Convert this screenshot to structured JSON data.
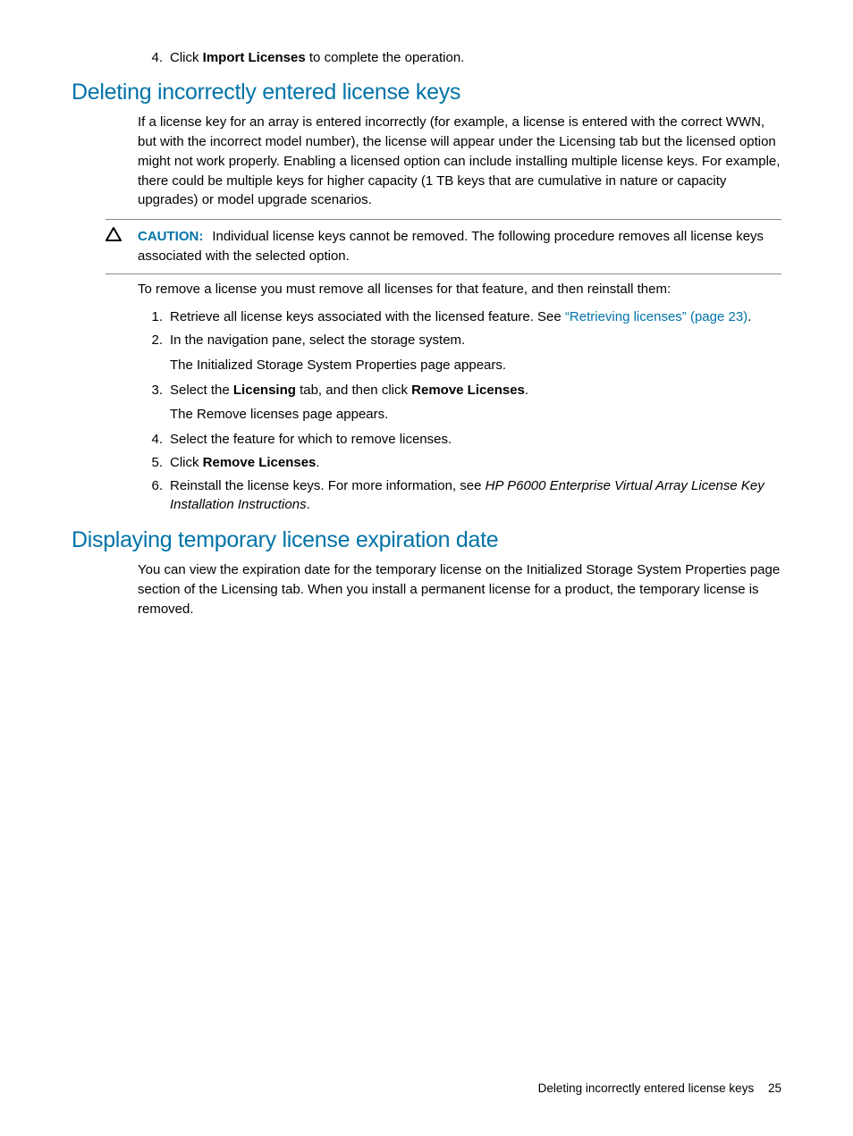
{
  "step4_top": {
    "num": "4.",
    "prefix": "Click ",
    "bold": "Import Licenses",
    "suffix": " to complete the operation."
  },
  "h2_deleting": "Deleting incorrectly entered license keys",
  "p_deleting": "If a license key for an array is entered incorrectly (for example, a license is entered with the correct WWN, but with the incorrect model number), the license will appear under the Licensing tab but the licensed option might not work properly. Enabling a licensed option can include installing multiple license keys. For example, there could be multiple keys for higher capacity (1 TB keys that are cumulative in nature or capacity upgrades) or model upgrade scenarios.",
  "caution": {
    "label": "CAUTION:",
    "text": "Individual license keys cannot be removed. The following procedure removes all license keys associated with the selected option."
  },
  "p_remove_intro": "To remove a license you must remove all licenses for that feature, and then reinstall them:",
  "steps": {
    "s1": {
      "num": "1.",
      "prefix": "Retrieve all license keys associated with the licensed feature. See ",
      "link": "“Retrieving licenses” (page 23)",
      "suffix": "."
    },
    "s2": {
      "num": "2.",
      "text": "In the navigation pane, select the storage system.",
      "sub": "The Initialized Storage System Properties page appears."
    },
    "s3": {
      "num": "3.",
      "prefix": "Select the ",
      "bold1": "Licensing",
      "mid": " tab, and then click ",
      "bold2": "Remove Licenses",
      "suffix": ".",
      "sub": "The Remove licenses page appears."
    },
    "s4": {
      "num": "4.",
      "text": "Select the feature for which to remove licenses."
    },
    "s5": {
      "num": "5.",
      "prefix": "Click ",
      "bold": "Remove Licenses",
      "suffix": "."
    },
    "s6": {
      "num": "6.",
      "prefix": "Reinstall the license keys. For more information, see ",
      "italic": "HP P6000 Enterprise Virtual Array License Key Installation Instructions",
      "suffix": "."
    }
  },
  "h2_displaying": "Displaying temporary license expiration date",
  "p_displaying": "You can view the expiration date for the temporary license on the Initialized Storage System Properties page section of the Licensing tab. When you install a permanent license for a product, the temporary license is removed.",
  "footer": {
    "text": "Deleting incorrectly entered license keys",
    "page": "25"
  }
}
